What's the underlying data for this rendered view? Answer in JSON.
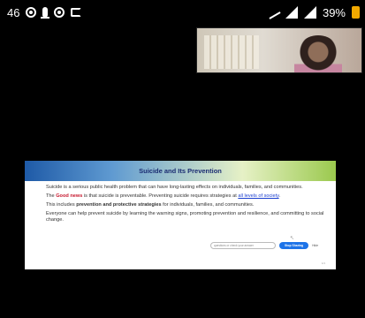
{
  "status": {
    "time": "46",
    "battery": "39%"
  },
  "video": {
    "label": "participant video"
  },
  "slide": {
    "title": "Suicide and Its Prevention",
    "para1": "Suicide is a serious public health problem that can have long-lasting effects on individuals, families, and communities.",
    "para2_prefix": "The ",
    "para2_good": "Good news",
    "para2_middle": " is that suicide is preventable. Preventing suicide requires strategies at ",
    "para2_link": "all levels of society",
    "para2_suffix": ".",
    "para3_prefix": "This includes ",
    "para3_bold": "prevention and protective strategies",
    "para3_suffix": " for individuals, families, and communities.",
    "para4": "Everyone can help prevent suicide by learning the warning signs, promoting prevention and resilience, and committing to social change.",
    "widget_input": "questions or check your answer",
    "widget_button": "Stop Sharing",
    "widget_small": "Hide",
    "cursor": "↖",
    "page": "1/1"
  }
}
